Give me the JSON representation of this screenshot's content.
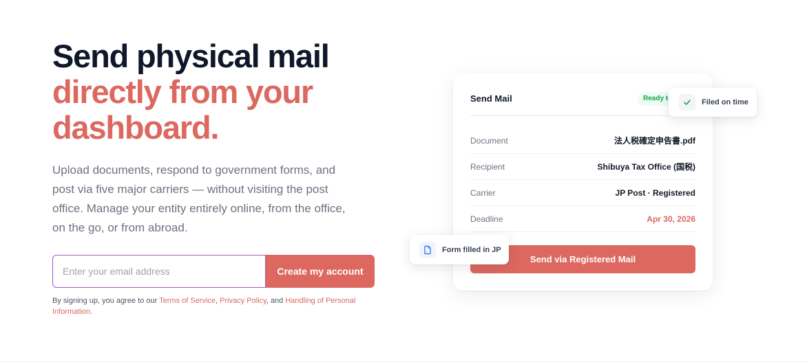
{
  "hero": {
    "headline_line1": "Send physical mail",
    "headline_line2": "directly from your",
    "headline_line3": "dashboard.",
    "subtext": "Upload documents, respond to government forms, and post via five major carriers — without visiting the post office. Manage your entity entirely online, from the office, on the go, or from abroad."
  },
  "signup": {
    "email_placeholder": "Enter your email address",
    "email_value": "",
    "cta_label": "Create my account"
  },
  "legal": {
    "prefix": "By signing up, you agree to our ",
    "terms": "Terms of Service",
    "sep1": ", ",
    "privacy": "Privacy Policy",
    "sep2": ", and ",
    "handling": "Handling of Personal Information",
    "suffix": "."
  },
  "card": {
    "title": "Send Mail",
    "badge": "Ready to send",
    "rows": [
      {
        "label": "Document",
        "value": "法人税確定申告書.pdf"
      },
      {
        "label": "Recipient",
        "value": "Shibuya Tax Office (国税)"
      },
      {
        "label": "Carrier",
        "value": "JP Post · Registered"
      },
      {
        "label": "Deadline",
        "value": "Apr 30, 2026"
      }
    ],
    "send_button": "Send via Registered Mail"
  },
  "chips": {
    "filed": "Filed on time",
    "form": "Form filled in JP"
  },
  "colors": {
    "accent": "#dc6860",
    "heading": "#0f172a",
    "success": "#16a34a",
    "input_focus": "#a855c7"
  },
  "icons": {
    "check": "check-icon",
    "document": "document-icon"
  }
}
